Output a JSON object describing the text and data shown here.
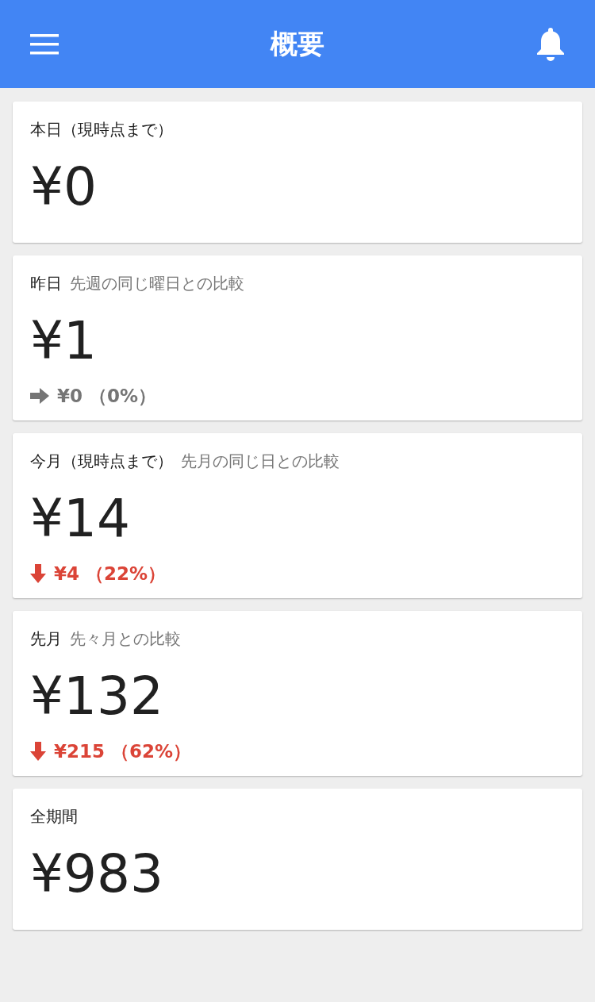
{
  "header": {
    "title": "概要"
  },
  "cards": [
    {
      "label": "本日（現時点まで）",
      "amount": "¥0"
    },
    {
      "label": "昨日",
      "comparison": "先週の同じ曜日との比較",
      "amount": "¥1",
      "change": {
        "kind": "flat",
        "text": "¥0 （0%）"
      }
    },
    {
      "label": "今月（現時点まで）",
      "comparison": "先月の同じ日との比較",
      "amount": "¥14",
      "change": {
        "kind": "down",
        "text": "¥4 （22%）"
      }
    },
    {
      "label": "先月",
      "comparison": "先々月との比較",
      "amount": "¥132",
      "change": {
        "kind": "down",
        "text": "¥215 （62%）"
      }
    },
    {
      "label": "全期間",
      "amount": "¥983"
    }
  ]
}
